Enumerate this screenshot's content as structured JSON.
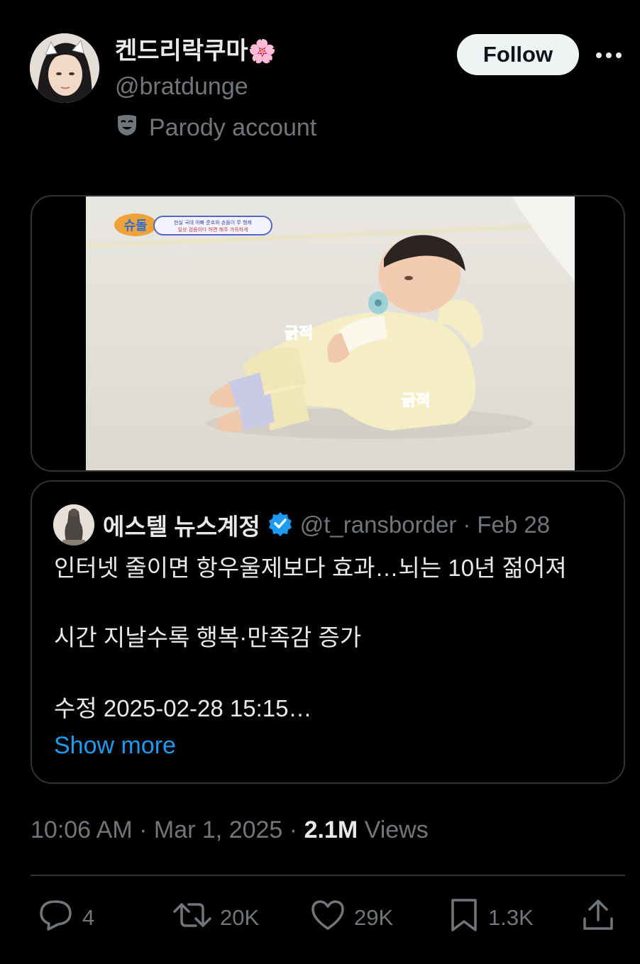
{
  "author": {
    "display_name": "켄드리락쿠마",
    "name_emoji": "🌸",
    "handle": "@bratdunge",
    "parody_label": "Parody account"
  },
  "header": {
    "follow_label": "Follow"
  },
  "media": {
    "caption_1": "긁적",
    "caption_2": "긁적",
    "logo_text": "슈돌",
    "banner_line_1": "현실 국대 아빠 준호와 손돌이 쭈 형제",
    "banner_line_2": "일상 검음이다 하면 해주 가득하게"
  },
  "quote": {
    "name": "에스텔 뉴스계정",
    "handle": "@t_ransborder",
    "separator": "·",
    "date": "Feb 28",
    "line_1": "인터넷 줄이면 항우울제보다 효과…뇌는 10년 젊어져",
    "line_2": "시간 지날수록 행복·만족감 증가",
    "line_3": "수정 2025-02-28 15:15…",
    "show_more": "Show more"
  },
  "tweet_meta": {
    "time": "10:06 AM",
    "sep1": "·",
    "date": "Mar 1, 2025",
    "sep2": "·",
    "views_count": "2.1M",
    "views_label": "Views"
  },
  "actions": {
    "replies": "4",
    "reposts": "20K",
    "likes": "29K",
    "bookmarks": "1.3K"
  },
  "colors": {
    "background": "#000000",
    "text_primary": "#e7e9ea",
    "text_secondary": "#71767b",
    "link": "#1d9bf0",
    "verified": "#1d9bf0",
    "border": "#2f3336"
  },
  "icons": [
    "more-icon",
    "parody-mask-icon",
    "verified-badge-icon",
    "reply-icon",
    "repost-icon",
    "like-icon",
    "bookmark-icon",
    "share-icon"
  ]
}
